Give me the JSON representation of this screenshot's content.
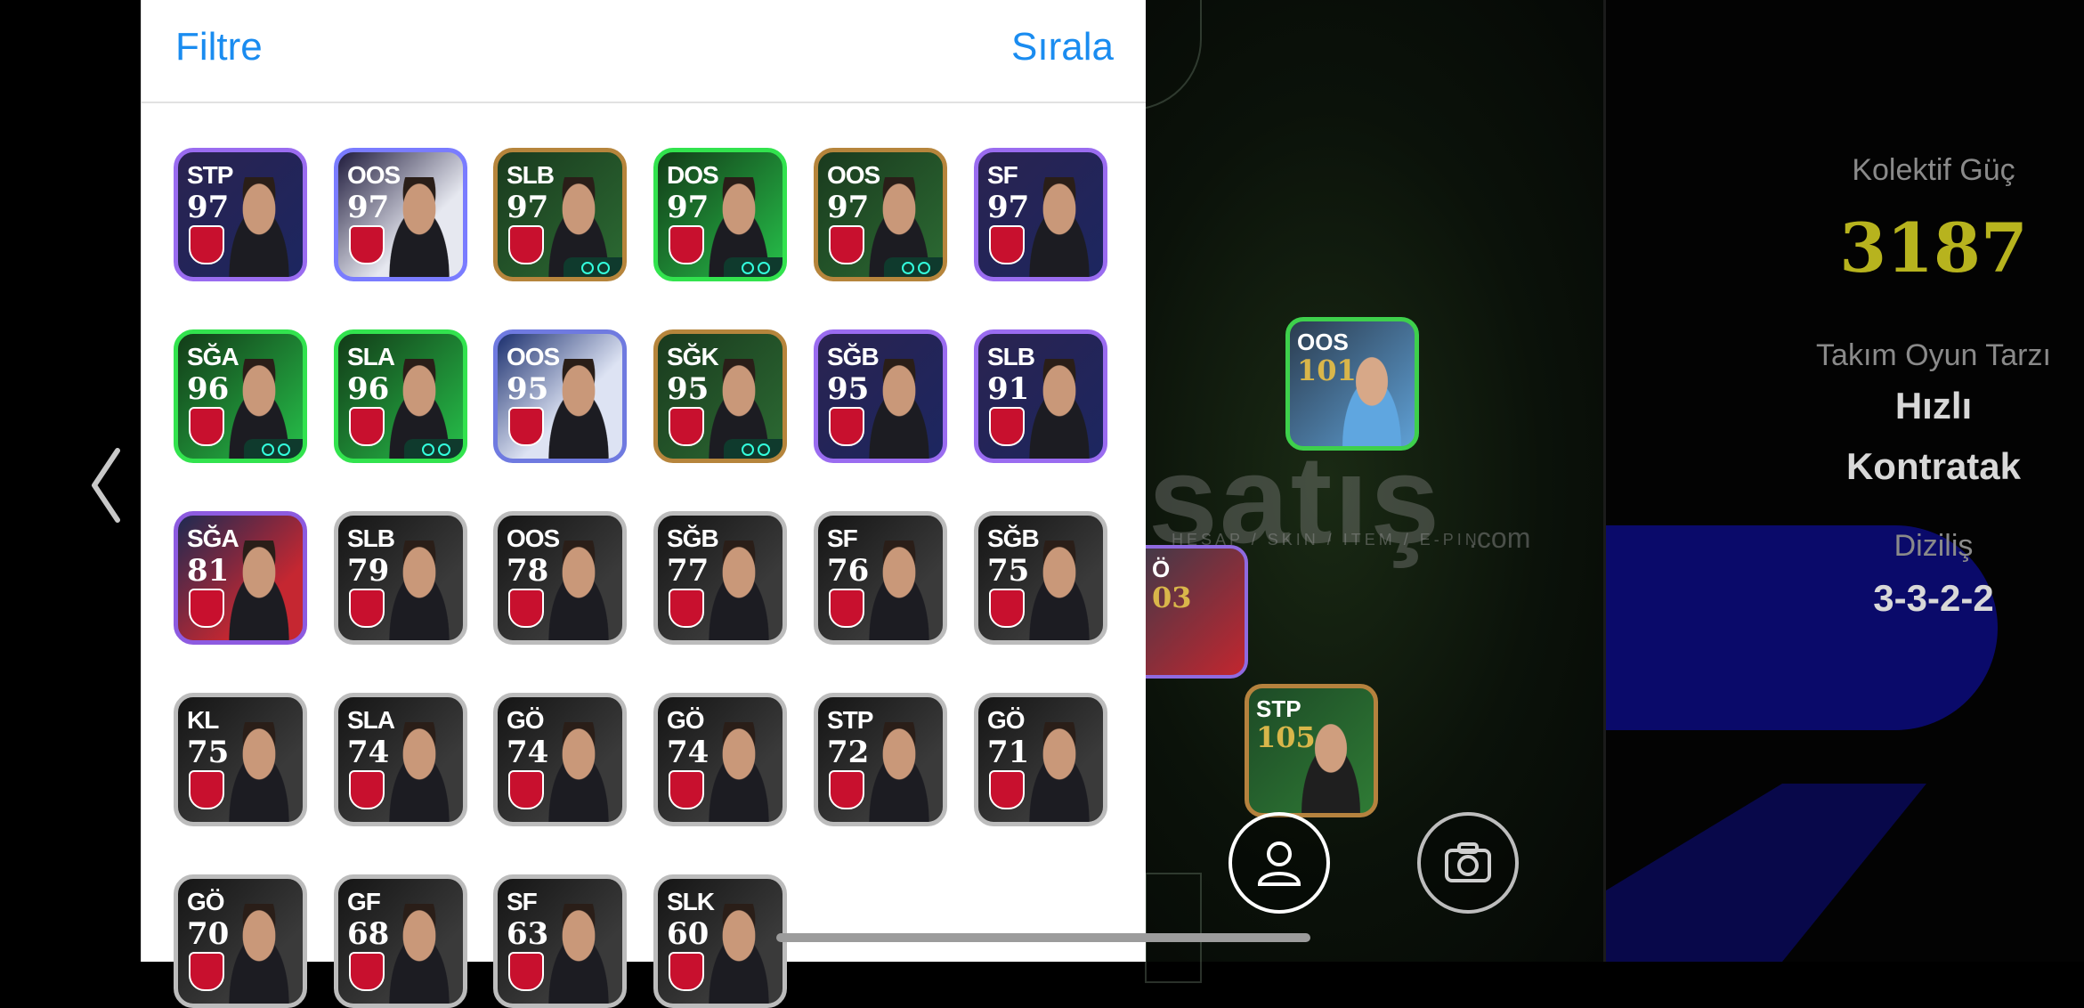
{
  "panel": {
    "filter_label": "Filtre",
    "sort_label": "Sırala"
  },
  "players": [
    {
      "pos": "STP",
      "rating": "97",
      "style": "bg-purple"
    },
    {
      "pos": "OOS",
      "rating": "97",
      "style": "bg-grad"
    },
    {
      "pos": "SLB",
      "rating": "97",
      "style": "bg-gold"
    },
    {
      "pos": "DOS",
      "rating": "97",
      "style": "bg-green"
    },
    {
      "pos": "OOS",
      "rating": "97",
      "style": "bg-gold"
    },
    {
      "pos": "SF",
      "rating": "97",
      "style": "bg-purple"
    },
    {
      "pos": "SĞA",
      "rating": "96",
      "style": "bg-green"
    },
    {
      "pos": "SLA",
      "rating": "96",
      "style": "bg-green"
    },
    {
      "pos": "OOS",
      "rating": "95",
      "style": "bg-white"
    },
    {
      "pos": "SĞK",
      "rating": "95",
      "style": "bg-gold"
    },
    {
      "pos": "SĞB",
      "rating": "95",
      "style": "bg-purple"
    },
    {
      "pos": "SLB",
      "rating": "91",
      "style": "bg-purple"
    },
    {
      "pos": "SĞA",
      "rating": "81",
      "style": "bg-red"
    },
    {
      "pos": "SLB",
      "rating": "79",
      "style": "bg-dark"
    },
    {
      "pos": "OOS",
      "rating": "78",
      "style": "bg-dark"
    },
    {
      "pos": "SĞB",
      "rating": "77",
      "style": "bg-dark"
    },
    {
      "pos": "SF",
      "rating": "76",
      "style": "bg-dark"
    },
    {
      "pos": "SĞB",
      "rating": "75",
      "style": "bg-dark"
    },
    {
      "pos": "KL",
      "rating": "75",
      "style": "bg-dark"
    },
    {
      "pos": "SLA",
      "rating": "74",
      "style": "bg-dark"
    },
    {
      "pos": "GÖ",
      "rating": "74",
      "style": "bg-dark"
    },
    {
      "pos": "GÖ",
      "rating": "74",
      "style": "bg-dark"
    },
    {
      "pos": "STP",
      "rating": "72",
      "style": "bg-dark"
    },
    {
      "pos": "GÖ",
      "rating": "71",
      "style": "bg-dark"
    },
    {
      "pos": "GÖ",
      "rating": "70",
      "style": "bg-dark"
    },
    {
      "pos": "GF",
      "rating": "68",
      "style": "bg-dark"
    },
    {
      "pos": "SF",
      "rating": "63",
      "style": "bg-dark"
    },
    {
      "pos": "SLK",
      "rating": "60",
      "style": "bg-dark"
    }
  ],
  "field": {
    "cards": [
      {
        "pos": "OOS",
        "rating": "101"
      },
      {
        "pos": "Ö",
        "rating": "03"
      },
      {
        "pos": "STP",
        "rating": "105"
      }
    ],
    "profile_icon": "person-icon",
    "camera_icon": "camera-icon"
  },
  "watermark": {
    "main": "satış",
    "sub": "HESAP / SKIN / ITEM / E-PIN",
    "com": ".com"
  },
  "info": {
    "power_label": "Kolektif Güç",
    "power_value": "3187",
    "style_label": "Takım Oyun Tarzı",
    "style_value_1": "Hızlı",
    "style_value_2": "Kontratak",
    "formation_label": "Diziliş",
    "formation_value": "3-3-2-2"
  }
}
